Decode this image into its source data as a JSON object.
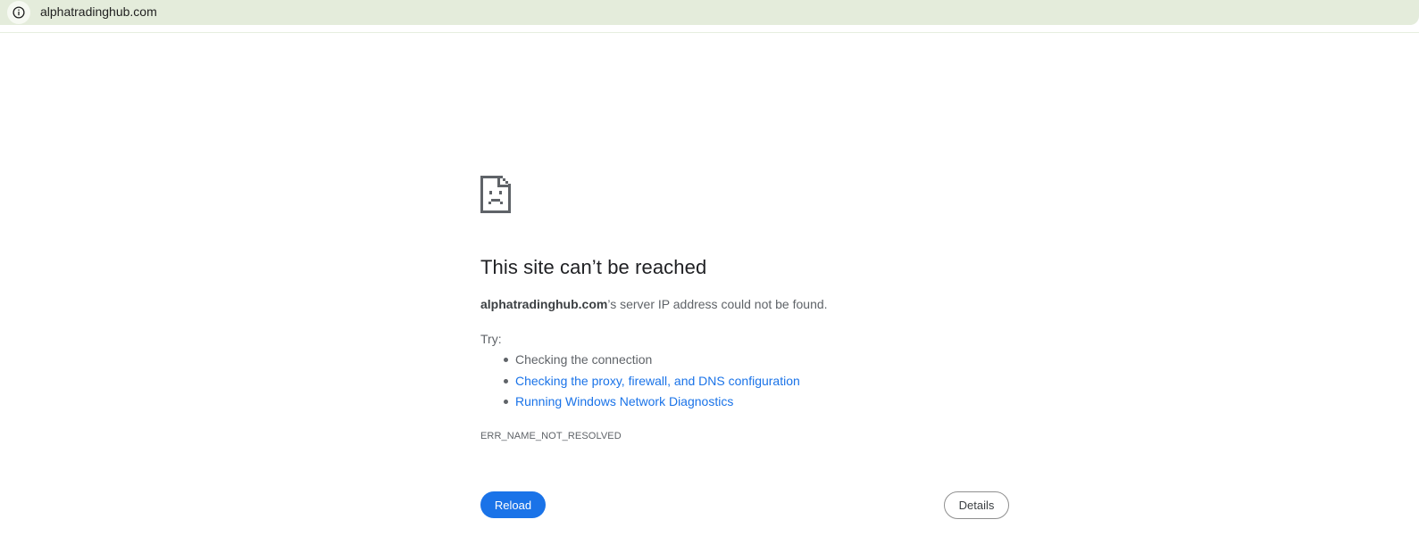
{
  "browser": {
    "url": "alphatradinghub.com",
    "site_info_icon": "info-icon",
    "toolbar_color": "#e4ecdb"
  },
  "error_page": {
    "icon": "sad-page-icon",
    "heading": "This site can’t be reached",
    "summary_host": "alphatradinghub.com",
    "summary_rest": "’s server IP address could not be found.",
    "try_label": "Try:",
    "suggestions": [
      {
        "label": "Checking the connection",
        "is_link": false
      },
      {
        "label": "Checking the proxy, firewall, and DNS configuration",
        "is_link": true
      },
      {
        "label": "Running Windows Network Diagnostics",
        "is_link": true
      }
    ],
    "error_code": "ERR_NAME_NOT_RESOLVED",
    "reload_label": "Reload",
    "details_label": "Details",
    "accent_color": "#1a73e8"
  }
}
